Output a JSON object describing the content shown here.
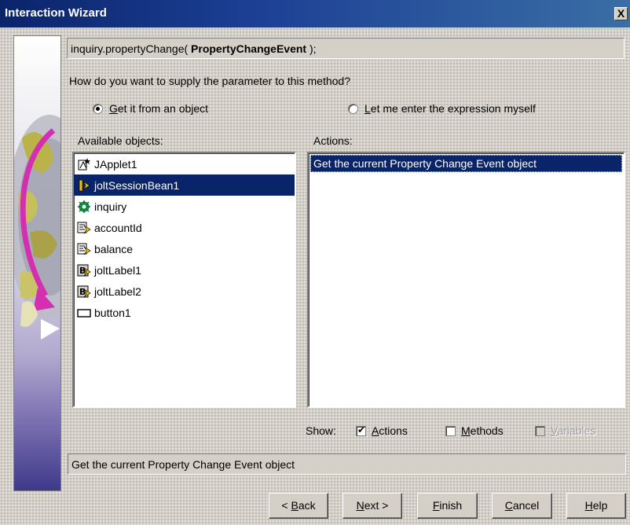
{
  "window": {
    "title": "Interaction Wizard",
    "close_glyph": "X",
    "accent": "#0a246a"
  },
  "expression": {
    "prefix": "inquiry.propertyChange( ",
    "param": "PropertyChangeEvent",
    "suffix": "  );"
  },
  "question": "How do you want to supply the parameter to this method?",
  "options": {
    "from_object": {
      "label": "Get it from an object",
      "accel": "G",
      "rest": "et it from an object",
      "selected": true
    },
    "enter_expression": {
      "label": "Let me enter the expression myself",
      "accel": "L",
      "rest": "et me enter the expression myself",
      "selected": false
    }
  },
  "available": {
    "label": "Available objects:",
    "items": [
      {
        "name": "JApplet1",
        "icon": "applet-icon",
        "selected": false
      },
      {
        "name": "joltSessionBean1",
        "icon": "session-bean-icon",
        "selected": true
      },
      {
        "name": "inquiry",
        "icon": "bean-icon",
        "selected": false
      },
      {
        "name": "accountId",
        "icon": "field-icon",
        "selected": false
      },
      {
        "name": "balance",
        "icon": "field-icon",
        "selected": false
      },
      {
        "name": "joltLabel1",
        "icon": "label-icon",
        "selected": false
      },
      {
        "name": "joltLabel2",
        "icon": "label-icon",
        "selected": false
      },
      {
        "name": "button1",
        "icon": "button-icon",
        "selected": false
      }
    ]
  },
  "actions": {
    "label": "Actions:",
    "items": [
      {
        "text": "Get the current Property Change Event object",
        "selected": true
      }
    ]
  },
  "show": {
    "label": "Show:",
    "actions": {
      "accel": "A",
      "rest": "ctions",
      "checked": true,
      "enabled": true
    },
    "methods": {
      "accel": "M",
      "rest": "ethods",
      "checked": false,
      "enabled": true
    },
    "variables": {
      "accel": "V",
      "rest": "ariables",
      "checked": false,
      "enabled": false
    }
  },
  "description": "Get the current Property Change Event object",
  "buttons": {
    "back": {
      "pre": "< ",
      "accel": "B",
      "rest": "ack"
    },
    "next": {
      "accel": "N",
      "rest": "ext >"
    },
    "finish": {
      "accel": "F",
      "rest": "inish"
    },
    "cancel": {
      "accel": "C",
      "rest": "ancel"
    },
    "help": {
      "accel": "H",
      "rest": "elp"
    }
  }
}
